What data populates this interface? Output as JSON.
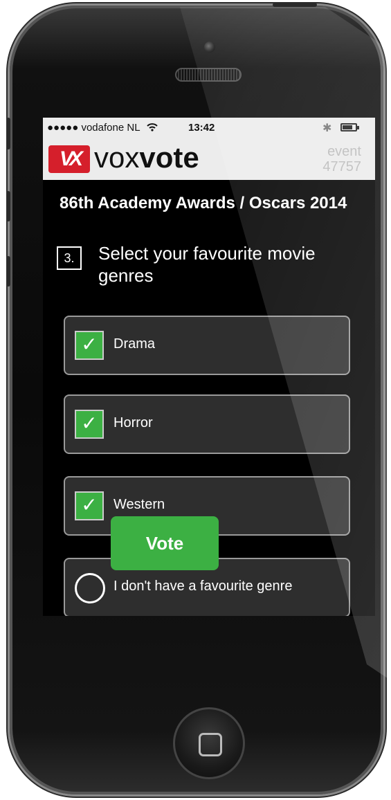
{
  "status_bar": {
    "carrier": "●●●●● vodafone NL",
    "wifi_icon": "wifi-icon",
    "time": "13:42",
    "bluetooth_icon": "bluetooth-icon",
    "battery_icon": "battery-icon"
  },
  "brand": {
    "logo_text": "VX",
    "name_part1": "vox",
    "name_part2": "vote",
    "event_label": "event",
    "event_id": "47757"
  },
  "event_title": "86th Academy Awards / Oscars 2014",
  "question": {
    "number": "3.",
    "text": "Select your favourite movie genres"
  },
  "options": [
    {
      "label": "Drama",
      "selected": true
    },
    {
      "label": "Horror",
      "selected": true
    },
    {
      "label": "Western",
      "selected": true
    },
    {
      "label": "I don't have a favourite genre",
      "selected": false
    }
  ],
  "vote_label": "Vote",
  "colors": {
    "accent_green": "#3cb043",
    "logo_red": "#d51f2b",
    "screen_bg": "#000000",
    "option_bg": "#2e2e2e"
  }
}
